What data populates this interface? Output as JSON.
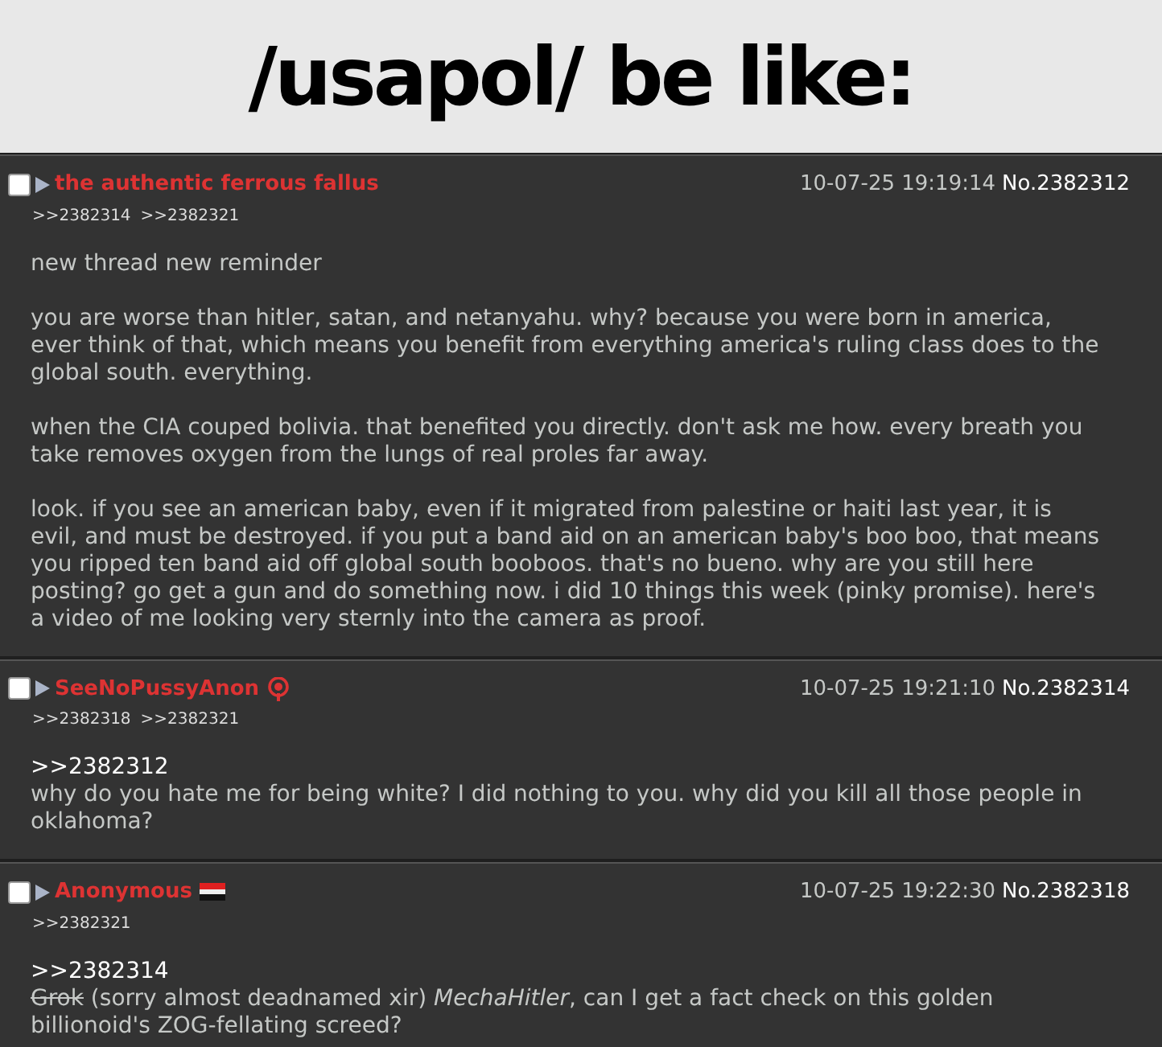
{
  "title": "/usapol/ be like:",
  "posts": [
    {
      "name": "the authentic ferrous fallus",
      "date": "10-07-25 19:19:14",
      "number": "No.2382312",
      "checked": false,
      "backlinks": [
        ">>2382314",
        ">>2382321"
      ],
      "paragraphs": [
        {
          "kind": "text",
          "text": "new thread new reminder"
        },
        {
          "kind": "text",
          "text": "you are worse than hitler, satan, and netanyahu. why? because you were born in america, ever think of that, which means you benefit from everything america's ruling class does to the global south. everything."
        },
        {
          "kind": "text",
          "text": "when the CIA couped bolivia. that benefited you directly. don't ask me how. every breath you take removes oxygen from the lungs of real proles far away."
        },
        {
          "kind": "text",
          "text": "look. if you see an american baby, even if it migrated from palestine or haiti last year, it is evil, and must be destroyed. if you put a band aid on an american baby's boo boo, that means you ripped ten band aid off global south booboos. that's no bueno. why are you still here posting? go get a gun and do something now. i did 10 things this week (pinky promise). here's a video of me looking very sternly into the camera as proof."
        }
      ]
    },
    {
      "name": "SeeNoPussyAnon",
      "badge": {
        "kind": "emblem"
      },
      "date": "10-07-25 19:21:10",
      "number": "No.2382314",
      "checked": false,
      "backlinks": [
        ">>2382318",
        ">>2382321"
      ],
      "paragraphs": [
        {
          "kind": "quote",
          "text": ">>2382312"
        },
        {
          "kind": "text",
          "text": "why do you hate me for being white? I did nothing to you. why did you kill all those people in oklahoma?"
        }
      ]
    },
    {
      "name": "Anonymous",
      "badge": {
        "kind": "flag"
      },
      "date": "10-07-25 19:22:30",
      "number": "No.2382318",
      "checked": false,
      "backlinks": [
        ">>2382321"
      ],
      "paragraphs": [
        {
          "kind": "quote",
          "text": ">>2382314"
        },
        {
          "kind": "text",
          "strike": "Grok",
          "text": " (sorry almost deadnamed xir) *MechaHitler*, can I get a fact check on this golden billionoid's ZOG-fellating screed?"
        }
      ]
    }
  ]
}
